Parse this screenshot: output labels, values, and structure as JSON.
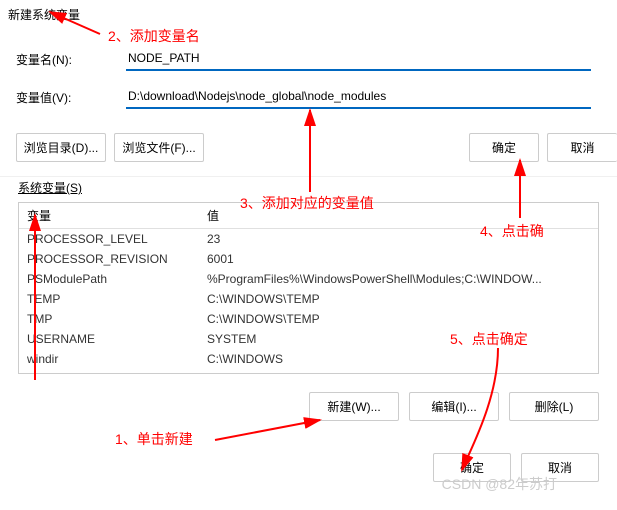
{
  "dialog": {
    "title": "新建系统变量"
  },
  "form": {
    "name_label": "变量名(N):",
    "name_value": "NODE_PATH",
    "value_label": "变量值(V):",
    "value_value": "D:\\download\\Nodejs\\node_global\\node_modules"
  },
  "buttons": {
    "browse_dir": "浏览目录(D)...",
    "browse_file": "浏览文件(F)...",
    "ok": "确定",
    "cancel": "取消",
    "new": "新建(W)...",
    "edit": "编辑(I)...",
    "delete": "删除(L)"
  },
  "section": {
    "system_vars": "系统变量(S)"
  },
  "table": {
    "headers": {
      "variable": "变量",
      "value": "值"
    },
    "rows": [
      {
        "variable": "PROCESSOR_LEVEL",
        "value": "23"
      },
      {
        "variable": "PROCESSOR_REVISION",
        "value": "6001"
      },
      {
        "variable": "PSModulePath",
        "value": "%ProgramFiles%\\WindowsPowerShell\\Modules;C:\\WINDOW..."
      },
      {
        "variable": "TEMP",
        "value": "C:\\WINDOWS\\TEMP"
      },
      {
        "variable": "TMP",
        "value": "C:\\WINDOWS\\TEMP"
      },
      {
        "variable": "USERNAME",
        "value": "SYSTEM"
      },
      {
        "variable": "windir",
        "value": "C:\\WINDOWS"
      }
    ]
  },
  "annotations": {
    "a1": "1、单击新建",
    "a2": "2、添加变量名",
    "a3": "3、添加对应的变量值",
    "a4": "4、点击确",
    "a5": "5、点击确定"
  },
  "watermark": "CSDN @82年苏打"
}
